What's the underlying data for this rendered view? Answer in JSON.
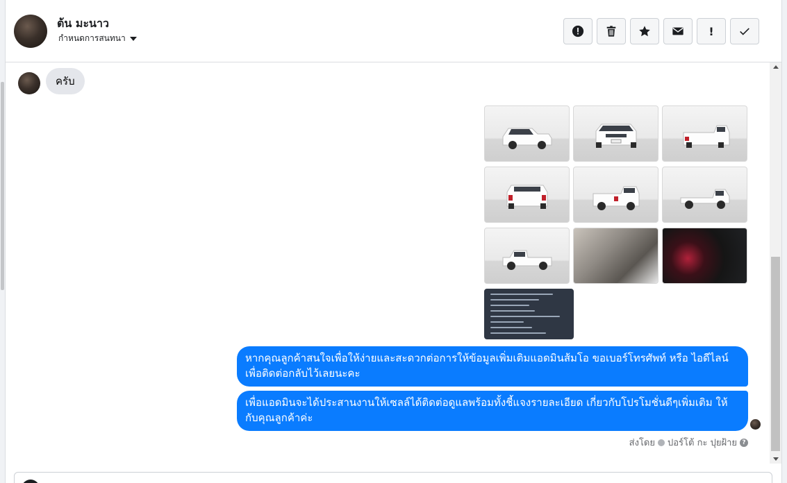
{
  "header": {
    "contact_name": "ต้น มะนาว",
    "assign_label": "กำหนดการสนทนา",
    "actions": [
      {
        "name": "alert-button",
        "icon": "exclamation-circle-icon",
        "label": ""
      },
      {
        "name": "delete-button",
        "icon": "trash-icon",
        "label": ""
      },
      {
        "name": "star-button",
        "icon": "star-icon",
        "label": ""
      },
      {
        "name": "mark-unread-button",
        "icon": "envelope-icon",
        "label": ""
      },
      {
        "name": "priority-button",
        "icon": "exclamation-icon",
        "label": "!"
      },
      {
        "name": "done-button",
        "icon": "check-icon",
        "label": ""
      }
    ]
  },
  "messages": {
    "incoming": [
      {
        "text": "ครับ"
      }
    ],
    "outgoing": [
      {
        "text": "หากคุณลูกค้าสนใจเพื่อให้ง่ายและสะดวกต่อการให้ข้อมูลเพิ่มเติมแอดมินส้มโอ ขอเบอร์โทรศัพท์ หรือ ไอดีไลน์ เพื่อติดต่อกลับไว้เลยนะคะ"
      },
      {
        "text": "เพื่อแอดมินจะได้ประสานงานให้เซลล์ได้ติดต่อดูแลพร้อมทั้งชี้แจงรายละเอียด เกี่ยวกับโปรโมชั่นดีๆเพิ่มเติม ให้กับคุณลูกค้าค่ะ"
      }
    ],
    "photos": [
      {
        "kind": "truck-front-left"
      },
      {
        "kind": "truck-front"
      },
      {
        "kind": "truck-rear-left"
      },
      {
        "kind": "truck-rear"
      },
      {
        "kind": "truck-rear-right"
      },
      {
        "kind": "truck-side"
      },
      {
        "kind": "truck-side-left"
      },
      {
        "kind": "interior"
      },
      {
        "kind": "dashboard"
      },
      {
        "kind": "spec-sheet"
      }
    ],
    "sent_by_label": "ส่งโดย",
    "sent_by_name": "ปอร์โต้ กะ ปุยฝ้าย",
    "help_icon": "question-circle-icon"
  },
  "colors": {
    "outgoing_bubble": "#0a7cff",
    "incoming_bubble": "#e4e6eb"
  }
}
